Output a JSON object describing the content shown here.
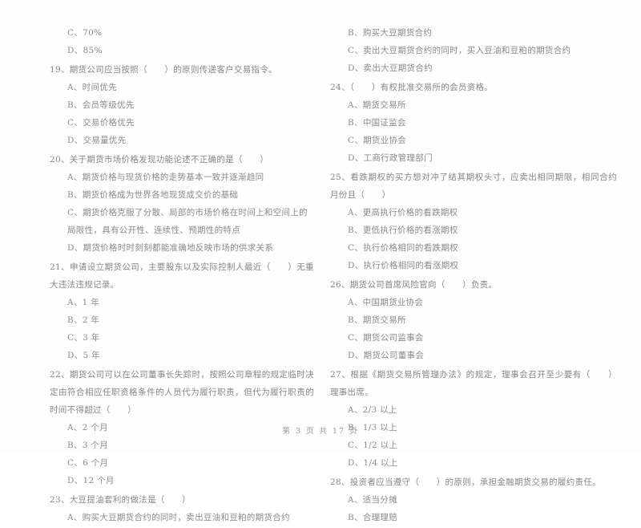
{
  "document": {
    "footer": "第 3 页 共 17 页",
    "page_number": "3",
    "total_pages": "17",
    "text_color": "#8a8a8a",
    "background_color": "#fdfdfd"
  },
  "left_column": {
    "carryover_options": [
      "C、70%",
      "D、85%"
    ],
    "questions": [
      {
        "number": "19",
        "stem": "19、期货公司应当按照（　　）的原则传递客户交易指令。",
        "options": [
          "A、时间优先",
          "B、会员等级优先",
          "C、交易价格优先",
          "D、交易量优先"
        ]
      },
      {
        "number": "20",
        "stem": "20、关于期货市场价格发现功能论述不正确的是（　　）",
        "options": [
          "A、期货价格与现货价格的走势基本一致并逐渐趋同",
          "B、期货价格成为世界各地现货成交价的基础",
          "C、期货价格克服了分散、局部的市场价格在时间上和空间上的局限性，具有公开性、连续性、预期性的特点",
          "D、期货价格时时刻刻都能准确地反映市场的供求关系"
        ]
      },
      {
        "number": "21",
        "stem": "21、申请设立期货公司，主要股东以及实际控制人最近（　　）无重大违法违规记录。",
        "options": [
          "A、1 年",
          "B、2 年",
          "C、3 年",
          "D、5 年"
        ]
      },
      {
        "number": "22",
        "stem": "22、期货公司可以在公司董事长失踪时，按照公司章程的规定临时决定由符合相应任职资格条件的人员代为履行职责，但代为履行职责的时间不得超过（　　）",
        "options": [
          "A、2 个月",
          "B、3 个月",
          "C、6 个月",
          "D、12 个月"
        ]
      },
      {
        "number": "23",
        "stem": "23、大豆提油套利的做法是（　　）",
        "options": [
          "A、购买大豆期货合约的同时，卖出豆油和豆粕的期货合约"
        ]
      }
    ]
  },
  "right_column": {
    "carryover_options": [
      "B、购买大豆期货合约",
      "C、卖出大豆期货合约的同时，买入豆油和豆粕的期货合约",
      "D、卖出大豆期货合约"
    ],
    "questions": [
      {
        "number": "24",
        "stem": "24、（　　）有权批准交易所的会员资格。",
        "options": [
          "A、期货交易所",
          "B、中国证监会",
          "C、期货业协会",
          "D、工商行政管理部门"
        ]
      },
      {
        "number": "25",
        "stem": "25、看跌期权的买方想对冲了结其期权头寸，应卖出相同期限，相同合约月份且（　　）",
        "options": [
          "A、更高执行价格的看跌期权",
          "B、更低执行价格的看涨期权",
          "C、执行价格相同的看跌期权",
          "D、执行价格相同的看涨期权"
        ]
      },
      {
        "number": "26",
        "stem": "26、期货公司首席风险官向（　　）负责。",
        "options": [
          "A、中国期货业协会",
          "B、期货交易所",
          "C、期货公司监事会",
          "D、期货公司董事会"
        ]
      },
      {
        "number": "27",
        "stem": "27、根据《期货交易所管理办法》的规定，理事会召开至少要有（　　）理事出席。",
        "options": [
          "A、2/3 以上",
          "B、1/3 以上",
          "C、1/2 以上",
          "D、1/4 以上"
        ]
      },
      {
        "number": "28",
        "stem": "28、投资者应当遵守（　　）的原则，承担金融期货交易的履约责任。",
        "options": [
          "A、适当分摊",
          "B、合理理赔"
        ]
      }
    ]
  }
}
